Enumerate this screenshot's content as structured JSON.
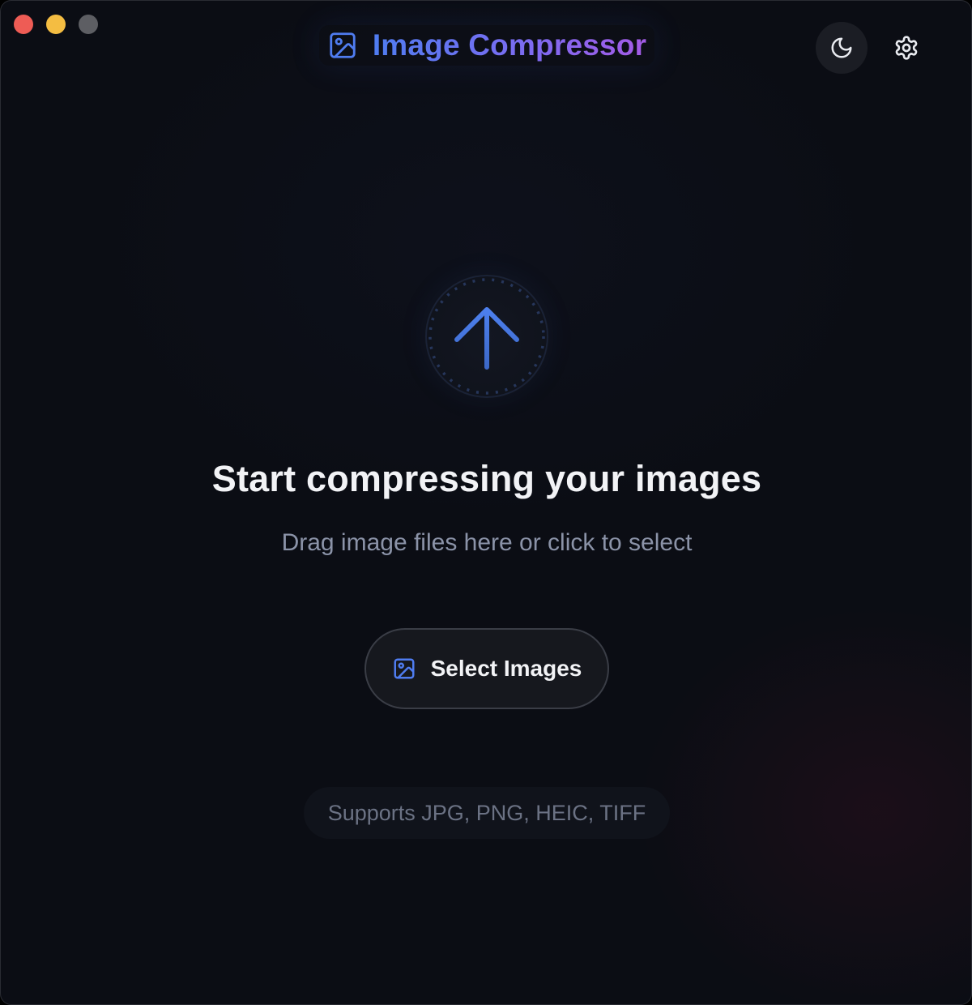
{
  "window": {
    "traffic_lights": {
      "close_color": "#ee5c55",
      "minimize_color": "#f4bd42",
      "maximize_color": "#5d5e63"
    }
  },
  "header": {
    "app_icon": "image-icon",
    "title": "Image Compressor",
    "title_gradient": [
      "#4f7cf0",
      "#7b6cf1",
      "#a45be6"
    ],
    "theme_toggle_icon": "moon-icon",
    "settings_icon": "gear-icon"
  },
  "dropzone": {
    "icon": "upload-arrow-icon",
    "accent_color": "#4a7ce0",
    "headline": "Start compressing your images",
    "subline": "Drag image files here or click to select",
    "select_button": {
      "icon": "image-icon",
      "label": "Select Images"
    },
    "supported_formats": "Supports JPG, PNG, HEIC, TIFF"
  }
}
